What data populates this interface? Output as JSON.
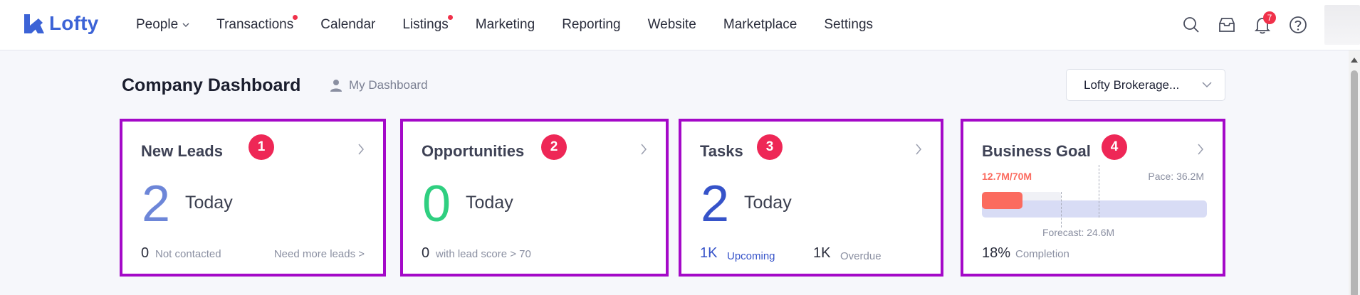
{
  "brand": {
    "name": "Lofty",
    "color": "#3c63d6"
  },
  "nav": [
    {
      "label": "People",
      "has_dropdown": true,
      "has_dot": false
    },
    {
      "label": "Transactions",
      "has_dropdown": false,
      "has_dot": true
    },
    {
      "label": "Calendar",
      "has_dropdown": false,
      "has_dot": false
    },
    {
      "label": "Listings",
      "has_dropdown": false,
      "has_dot": true
    },
    {
      "label": "Marketing",
      "has_dropdown": false,
      "has_dot": false
    },
    {
      "label": "Reporting",
      "has_dropdown": false,
      "has_dot": false
    },
    {
      "label": "Website",
      "has_dropdown": false,
      "has_dot": false
    },
    {
      "label": "Marketplace",
      "has_dropdown": false,
      "has_dot": false
    },
    {
      "label": "Settings",
      "has_dropdown": false,
      "has_dot": false
    }
  ],
  "toolbar": {
    "icons": [
      "search-icon",
      "inbox-icon",
      "bell-icon",
      "help-icon"
    ],
    "notification_count": "7"
  },
  "header": {
    "title": "Company Dashboard",
    "my_dashboard": "My Dashboard",
    "brokerage_select": "Lofty Brokerage..."
  },
  "cards": {
    "new_leads": {
      "title": "New Leads",
      "badge": "1",
      "count": "2",
      "period": "Today",
      "count_color": "#6d86d8",
      "footer_count": "0",
      "footer_label": "Not contacted",
      "link": "Need more leads >"
    },
    "opportunities": {
      "title": "Opportunities",
      "badge": "2",
      "count": "0",
      "period": "Today",
      "count_color": "#2fcf80",
      "footer_count": "0",
      "footer_label": "with lead score > 70"
    },
    "tasks": {
      "title": "Tasks",
      "badge": "3",
      "count": "2",
      "period": "Today",
      "count_color": "#3653c9",
      "upcoming_count": "1K",
      "upcoming_label": "Upcoming",
      "overdue_count": "1K",
      "overdue_label": "Overdue"
    },
    "business_goal": {
      "title": "Business Goal",
      "badge": "4",
      "progress_text": "12.7M/70M",
      "pace": "Pace: 36.2M",
      "forecast": "Forecast: 24.6M",
      "completion_value": "18%",
      "completion_label": "Completion",
      "progress_fraction": 0.18,
      "forecast_fraction": 0.35,
      "pace_fraction": 0.52,
      "progress_color": "#fb6b5f"
    }
  },
  "colors": {
    "card_border": "#a409c8",
    "badge": "#ee2756",
    "accent": "#3c63d6"
  }
}
